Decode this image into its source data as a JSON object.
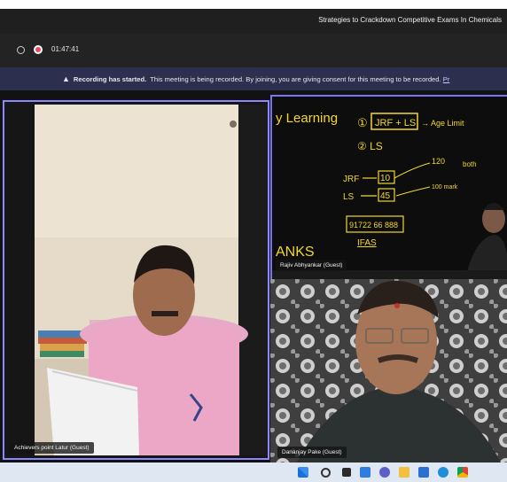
{
  "window": {
    "title": "Strategies to Crackdown Competitive Exams In Chemicals"
  },
  "toolbar": {
    "timer": "01:47:41"
  },
  "banner": {
    "bold": "Recording has started.",
    "text": "This meeting is being recorded. By joining, you are giving consent for this meeting to be recorded.",
    "link": "Pr"
  },
  "participants": [
    {
      "name": "Achievers point Latur (Guest)"
    },
    {
      "name": "Rajiv Abhyankar (Guest)"
    },
    {
      "name": "Dananjay Pake (Guest)"
    }
  ],
  "board": {
    "heading": "y Learning",
    "footer": "ANKS",
    "lines": {
      "l1_num": "①",
      "l1_box": "JRF + LS",
      "l1_note": "→ Age Limit",
      "l2": "② LS",
      "jrf": "JRF",
      "jrf_val": "10",
      "ls": "LS",
      "ls_val": "45",
      "n120": "120",
      "both": "both",
      "mark": "100 mark",
      "phone": "91722 66 888",
      "ifas": "IFAS"
    }
  },
  "taskbar": {
    "icons": [
      "windows-icon",
      "search-icon",
      "task-view-icon",
      "widgets-icon",
      "chat-icon",
      "file-explorer-icon",
      "store-icon",
      "edge-icon",
      "chrome-icon"
    ]
  }
}
